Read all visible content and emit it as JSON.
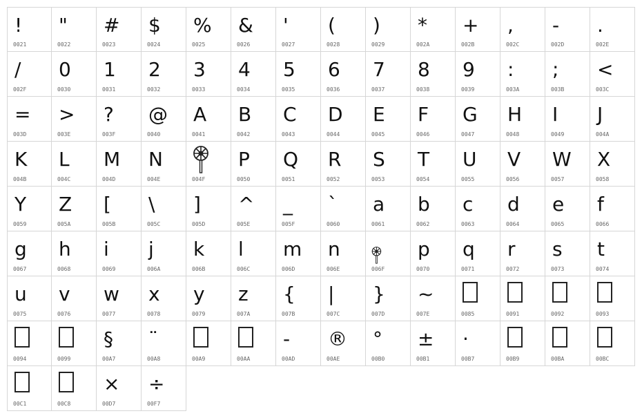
{
  "cells": [
    {
      "char": "!",
      "code": "0021"
    },
    {
      "char": "\"",
      "code": "0022"
    },
    {
      "char": "#",
      "code": "0023"
    },
    {
      "char": "$",
      "code": "0024"
    },
    {
      "char": "%",
      "code": "0025"
    },
    {
      "char": "&",
      "code": "0026"
    },
    {
      "char": "'",
      "code": "0027"
    },
    {
      "char": "(",
      "code": "0028"
    },
    {
      "char": ")",
      "code": "0029"
    },
    {
      "char": "*",
      "code": "002A"
    },
    {
      "char": "+",
      "code": "002B"
    },
    {
      "char": ",",
      "code": "002C"
    },
    {
      "char": "-",
      "code": "002D"
    },
    {
      "char": ".",
      "code": "002E"
    },
    {
      "char": "/",
      "code": "002F"
    },
    {
      "char": "0",
      "code": "0030"
    },
    {
      "char": "1",
      "code": "0031"
    },
    {
      "char": "2",
      "code": "0032"
    },
    {
      "char": "3",
      "code": "0033"
    },
    {
      "char": "4",
      "code": "0034"
    },
    {
      "char": "5",
      "code": "0035"
    },
    {
      "char": "6",
      "code": "0036"
    },
    {
      "char": "7",
      "code": "0037"
    },
    {
      "char": "8",
      "code": "0038"
    },
    {
      "char": "9",
      "code": "0039"
    },
    {
      "char": ":",
      "code": "003A"
    },
    {
      "char": ";",
      "code": "003B"
    },
    {
      "char": "<",
      "code": "003C"
    },
    {
      "char": "=",
      "code": "003D"
    },
    {
      "char": ">",
      "code": "003E"
    },
    {
      "char": "?",
      "code": "003F"
    },
    {
      "char": "@",
      "code": "0040"
    },
    {
      "char": "A",
      "code": "0041"
    },
    {
      "char": "B",
      "code": "0042"
    },
    {
      "char": "C",
      "code": "0043"
    },
    {
      "char": "D",
      "code": "0044"
    },
    {
      "char": "E",
      "code": "0045"
    },
    {
      "char": "F",
      "code": "0046"
    },
    {
      "char": "G",
      "code": "0047"
    },
    {
      "char": "H",
      "code": "0048"
    },
    {
      "char": "I",
      "code": "0049"
    },
    {
      "char": "J",
      "code": "004A"
    },
    {
      "char": "K",
      "code": "004B"
    },
    {
      "char": "L",
      "code": "004C"
    },
    {
      "char": "M",
      "code": "004D"
    },
    {
      "char": "N",
      "code": "004E"
    },
    {
      "char": "",
      "code": "004F",
      "icon": "lollipop-icon"
    },
    {
      "char": "P",
      "code": "0050"
    },
    {
      "char": "Q",
      "code": "0051"
    },
    {
      "char": "R",
      "code": "0052"
    },
    {
      "char": "S",
      "code": "0053"
    },
    {
      "char": "T",
      "code": "0054"
    },
    {
      "char": "U",
      "code": "0055"
    },
    {
      "char": "V",
      "code": "0056"
    },
    {
      "char": "W",
      "code": "0057"
    },
    {
      "char": "X",
      "code": "0058"
    },
    {
      "char": "Y",
      "code": "0059"
    },
    {
      "char": "Z",
      "code": "005A"
    },
    {
      "char": "[",
      "code": "005B"
    },
    {
      "char": "\\",
      "code": "005C"
    },
    {
      "char": "]",
      "code": "005D"
    },
    {
      "char": "^",
      "code": "005E"
    },
    {
      "char": "_",
      "code": "005F"
    },
    {
      "char": "`",
      "code": "0060"
    },
    {
      "char": "a",
      "code": "0061"
    },
    {
      "char": "b",
      "code": "0062"
    },
    {
      "char": "c",
      "code": "0063"
    },
    {
      "char": "d",
      "code": "0064"
    },
    {
      "char": "e",
      "code": "0065"
    },
    {
      "char": "f",
      "code": "0066"
    },
    {
      "char": "g",
      "code": "0067"
    },
    {
      "char": "h",
      "code": "0068"
    },
    {
      "char": "i",
      "code": "0069"
    },
    {
      "char": "j",
      "code": "006A"
    },
    {
      "char": "k",
      "code": "006B"
    },
    {
      "char": "l",
      "code": "006C"
    },
    {
      "char": "m",
      "code": "006D"
    },
    {
      "char": "n",
      "code": "006E"
    },
    {
      "char": "",
      "code": "006F",
      "icon": "lollipop-small-icon"
    },
    {
      "char": "p",
      "code": "0070"
    },
    {
      "char": "q",
      "code": "0071"
    },
    {
      "char": "r",
      "code": "0072"
    },
    {
      "char": "s",
      "code": "0073"
    },
    {
      "char": "t",
      "code": "0074"
    },
    {
      "char": "u",
      "code": "0075"
    },
    {
      "char": "v",
      "code": "0076"
    },
    {
      "char": "w",
      "code": "0077"
    },
    {
      "char": "x",
      "code": "0078"
    },
    {
      "char": "y",
      "code": "0079"
    },
    {
      "char": "z",
      "code": "007A"
    },
    {
      "char": "{",
      "code": "007B"
    },
    {
      "char": "|",
      "code": "007C"
    },
    {
      "char": "}",
      "code": "007D"
    },
    {
      "char": "~",
      "code": "007E"
    },
    {
      "char": "",
      "code": "0085",
      "icon": "missing-glyph-icon"
    },
    {
      "char": "",
      "code": "0091",
      "icon": "missing-glyph-icon"
    },
    {
      "char": "",
      "code": "0092",
      "icon": "missing-glyph-icon"
    },
    {
      "char": "",
      "code": "0093",
      "icon": "missing-glyph-icon"
    },
    {
      "char": "",
      "code": "0094",
      "icon": "missing-glyph-icon"
    },
    {
      "char": "",
      "code": "0099",
      "icon": "missing-glyph-icon"
    },
    {
      "char": "§",
      "code": "00A7"
    },
    {
      "char": "¨",
      "code": "00A8"
    },
    {
      "char": "",
      "code": "00A9",
      "icon": "missing-glyph-icon"
    },
    {
      "char": "",
      "code": "00AA",
      "icon": "missing-glyph-icon"
    },
    {
      "char": "-",
      "code": "00AD"
    },
    {
      "char": "®",
      "code": "00AE"
    },
    {
      "char": "°",
      "code": "00B0"
    },
    {
      "char": "±",
      "code": "00B1"
    },
    {
      "char": "·",
      "code": "00B7"
    },
    {
      "char": "",
      "code": "00B9",
      "icon": "missing-glyph-icon"
    },
    {
      "char": "",
      "code": "00BA",
      "icon": "missing-glyph-icon"
    },
    {
      "char": "",
      "code": "00BC",
      "icon": "missing-glyph-icon"
    },
    {
      "char": "",
      "code": "00C1",
      "icon": "missing-glyph-icon"
    },
    {
      "char": "",
      "code": "00C8",
      "icon": "missing-glyph-icon"
    },
    {
      "char": "×",
      "code": "00D7"
    },
    {
      "char": "÷",
      "code": "00F7"
    }
  ]
}
